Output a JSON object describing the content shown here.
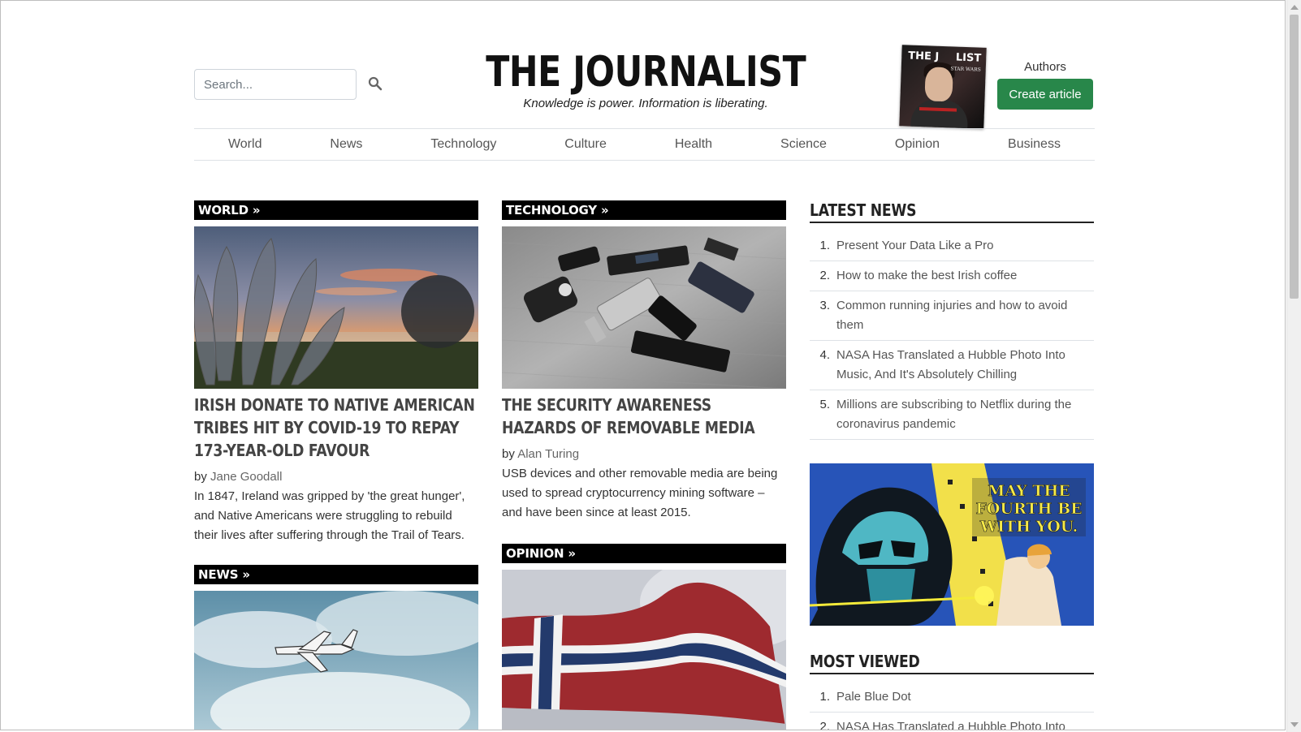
{
  "header": {
    "search_placeholder": "Search...",
    "logo": "THE JOURNALIST",
    "tagline": "Knowledge is power. Information is liberating.",
    "cover": {
      "title_left": "THE J",
      "title_right": "LIST",
      "subtitle": "STAR WARS"
    },
    "authors_label": "Authors",
    "create_label": "Create article"
  },
  "nav": [
    "World",
    "News",
    "Technology",
    "Culture",
    "Health",
    "Science",
    "Opinion",
    "Business"
  ],
  "sections": {
    "world": {
      "label": "WORLD »",
      "headline": "Irish donate to Native American tribes hit by COVID-19 to repay 173-year-old favour",
      "by": "by",
      "author": "Jane Goodall",
      "excerpt": "In 1847, Ireland was gripped by 'the great hunger', and Native Americans were struggling to rebuild their lives after suffering through the Trail of Tears."
    },
    "news": {
      "label": "NEWS »"
    },
    "technology": {
      "label": "TECHNOLOGY »",
      "headline": "The security awareness hazards of removable media",
      "by": "by",
      "author": "Alan Turing",
      "excerpt": "USB devices and other removable media are being used to spread cryptocurrency mining software – and have been since at least 2015."
    },
    "opinion": {
      "label": "OPINION »"
    }
  },
  "latest_news": {
    "heading": "LATEST NEWS",
    "items": [
      {
        "num": "1.",
        "title": "Present Your Data Like a Pro"
      },
      {
        "num": "2.",
        "title": "How to make the best Irish coffee"
      },
      {
        "num": "3.",
        "title": "Common running injuries and how to avoid them"
      },
      {
        "num": "4.",
        "title": "NASA Has Translated a Hubble Photo Into Music, And It's Absolutely Chilling"
      },
      {
        "num": "5.",
        "title": "Millions are subscribing to Netflix during the coronavirus pandemic"
      }
    ]
  },
  "ad": {
    "text": "MAY THE FOURTH BE WITH YOU."
  },
  "most_viewed": {
    "heading": "MOST VIEWED",
    "items": [
      {
        "num": "1.",
        "title": "Pale Blue Dot"
      },
      {
        "num": "2.",
        "title": "NASA Has Translated a Hubble Photo Into Music, And It's Absolutely Chilling"
      }
    ]
  },
  "colors": {
    "primary_button": "#28874a",
    "section_bar": "#000000",
    "text": "#333333"
  }
}
